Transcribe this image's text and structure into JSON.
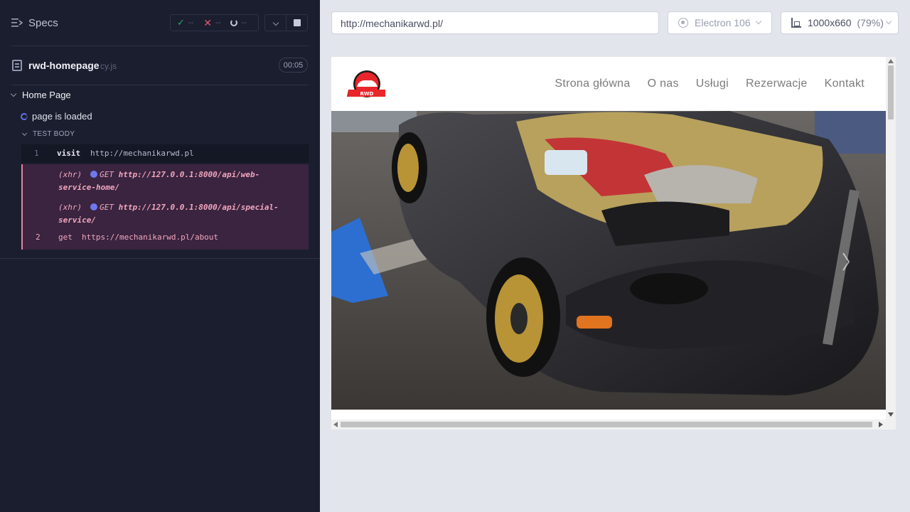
{
  "reporter": {
    "specs_label": "Specs",
    "stats": {
      "passed": "--",
      "failed": "--",
      "pending": "--"
    },
    "file": {
      "name": "rwd-homepage",
      "ext": "cy.js",
      "duration": "00:05"
    },
    "suite": "Home Page",
    "test": "page is loaded",
    "body_label": "TEST BODY",
    "commands": {
      "visit": {
        "num": "1",
        "name": "visit",
        "message": "http://mechanikarwd.pl"
      },
      "xhr1": {
        "tag": "(xhr)",
        "method": "GET",
        "url_line1": "http://127.0.0.1:8000/api/web-",
        "url_line2": "service-home/"
      },
      "xhr2": {
        "tag": "(xhr)",
        "method": "GET",
        "url_line1": "http://127.0.0.1:8000/api/special-",
        "url_line2": "service/"
      },
      "get": {
        "num": "2",
        "name": "get",
        "message": "https://mechanikarwd.pl/about"
      }
    }
  },
  "browser": {
    "url": "http://mechanikarwd.pl/",
    "browser_name": "Electron 106",
    "viewport": "1000x660",
    "zoom": "(79%)"
  },
  "site": {
    "logo_text": "RWD",
    "nav": [
      "Strona główna",
      "O nas",
      "Usługi",
      "Rezerwacje",
      "Kontakt"
    ]
  },
  "colors": {
    "reporter_bg": "#1b1e2e",
    "pass": "#1fa971",
    "fail": "#e45770",
    "running": "#6470f3",
    "failed_cmd_bg": "#3a2440"
  }
}
